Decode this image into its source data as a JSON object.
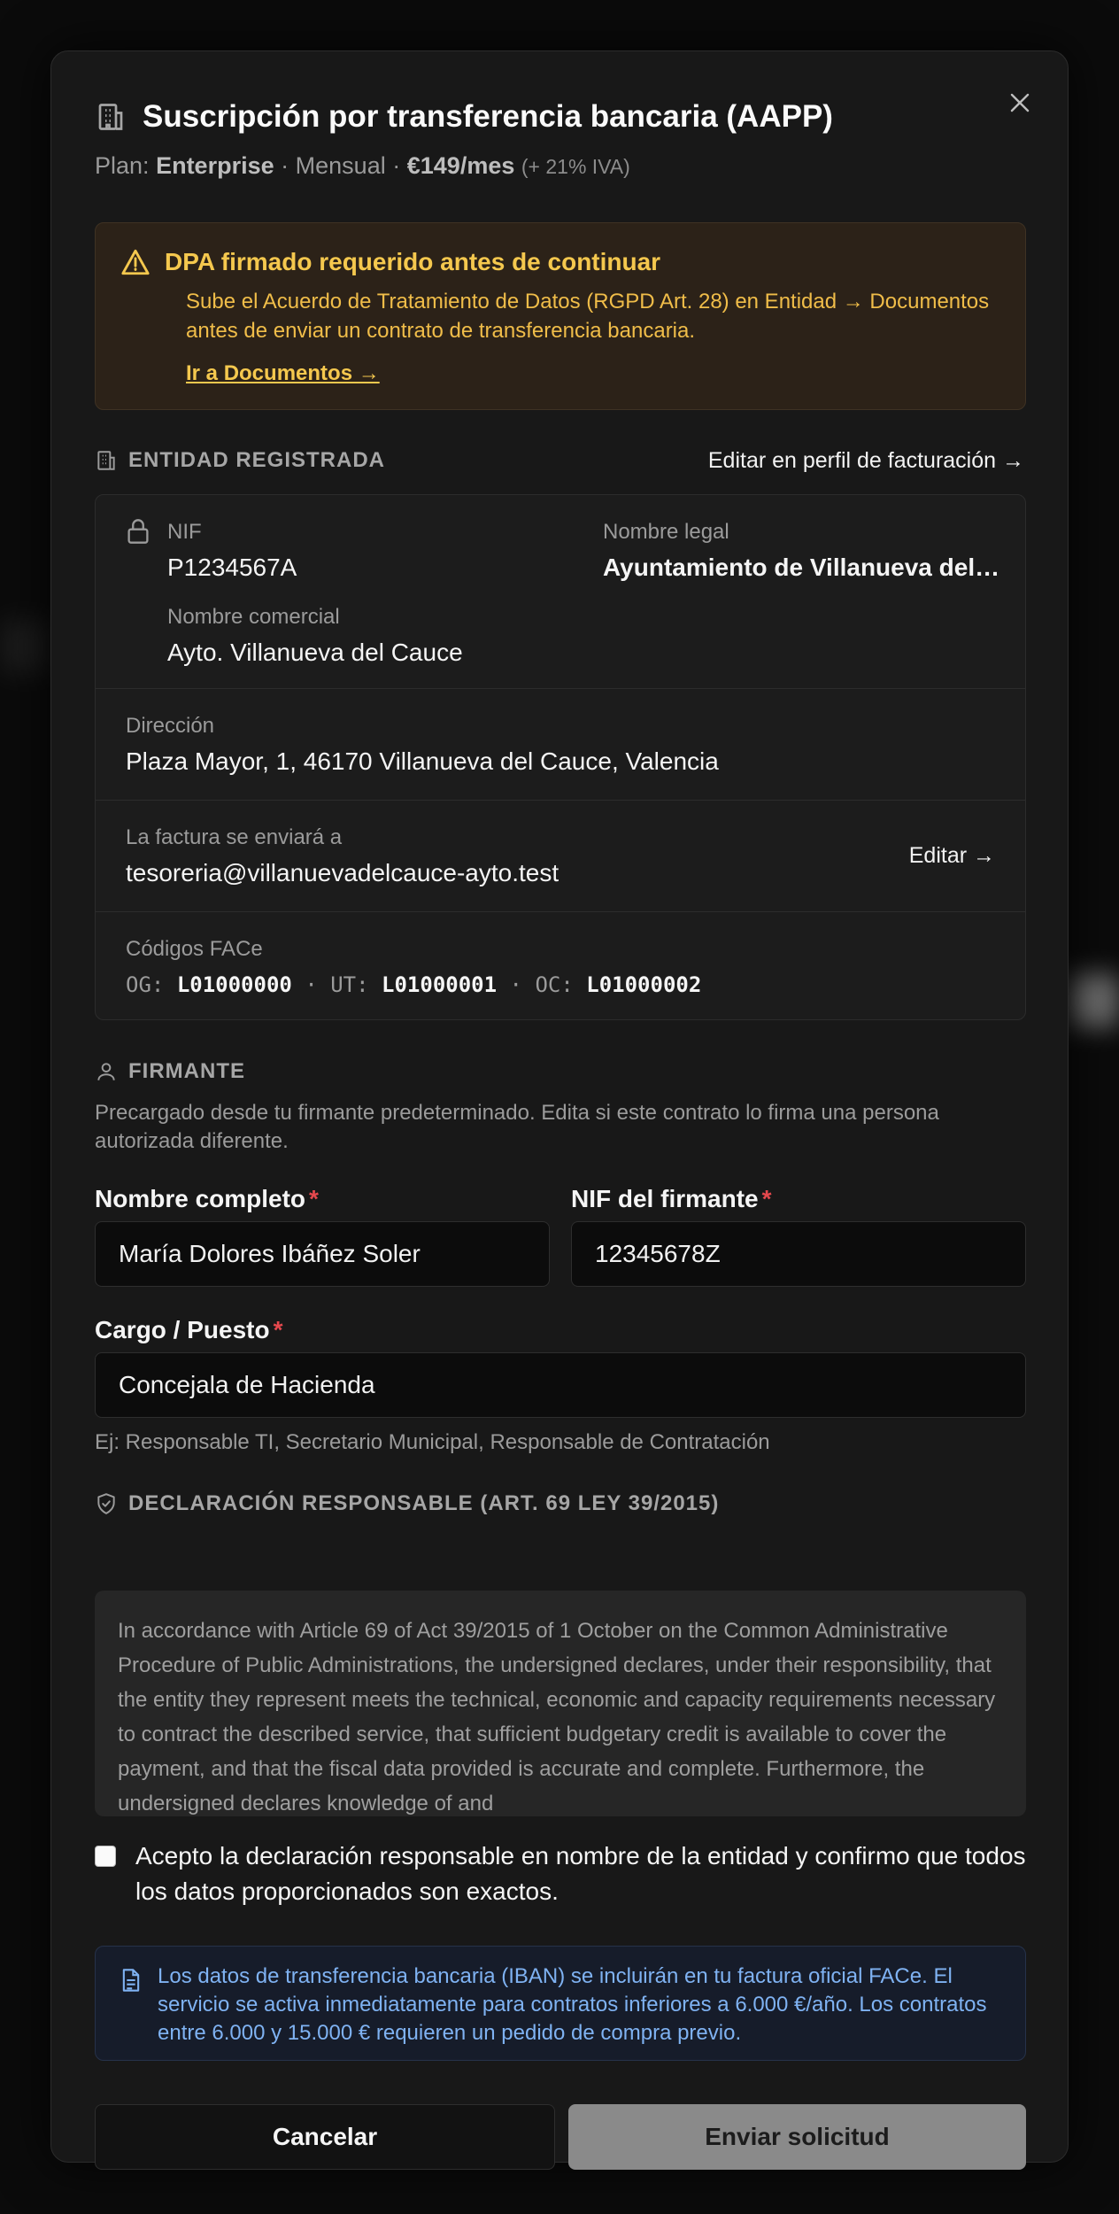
{
  "modal": {
    "title": "Suscripción por transferencia bancaria (AAPP)",
    "plan_prefix": "Plan:",
    "plan_name": "Enterprise",
    "plan_sep1": "·",
    "plan_period": "Mensual",
    "plan_sep2": "·",
    "plan_price": "€149/mes",
    "plan_tax": "(+ 21% IVA)",
    "close_icon": "close-icon"
  },
  "warning": {
    "title": "DPA firmado requerido antes de continuar",
    "body": "Sube el Acuerdo de Tratamiento de Datos (RGPD Art. 28) en Entidad → Documentos antes de enviar un contrato de transferencia bancaria.",
    "link": "Ir a Documentos →",
    "color": "#f5c84e"
  },
  "entity": {
    "section_label": "ENTIDAD REGISTRADA",
    "edit_link": "Editar en perfil de facturación →",
    "nif_label": "NIF",
    "nif_value": "P1234567A",
    "legal_name_label": "Nombre legal",
    "legal_name_value": "Ayuntamiento de Villanueva del Cauce",
    "trade_name_label": "Nombre comercial",
    "trade_name_value": "Ayto. Villanueva del Cauce",
    "address_label": "Dirección",
    "address_value": "Plaza Mayor, 1, 46170 Villanueva del Cauce, Valencia",
    "invoice_label": "La factura se enviará a",
    "invoice_value": "tesoreria@villanuevadelcauce-ayto.test",
    "invoice_edit": "Editar →",
    "face_label": "Códigos FACe",
    "face_og_key": "OG:",
    "face_og": "L01000000",
    "face_ut_key": "UT:",
    "face_ut": "L01000001",
    "face_oc_key": "OC:",
    "face_oc": "L01000002",
    "face_sep": "·"
  },
  "signer": {
    "section_label": "FIRMANTE",
    "hint": "Precargado desde tu firmante predeterminado. Edita si este contrato lo firma una persona autorizada diferente.",
    "name_label": "Nombre completo",
    "name_value": "María Dolores Ibáñez Soler",
    "nif_label": "NIF del firmante",
    "nif_value": "12345678Z",
    "role_label": "Cargo / Puesto",
    "role_value": "Concejala de Hacienda",
    "role_hint": "Ej: Responsable TI, Secretario Municipal, Responsable de Contratación",
    "required_mark": "*"
  },
  "declaration": {
    "section_label": "DECLARACIÓN RESPONSABLE (ART. 69 LEY 39/2015)",
    "text": "In accordance with Article 69 of Act 39/2015 of 1 October on the Common Administrative Procedure of Public Administrations, the undersigned declares, under their responsibility, that the entity they represent meets the technical, economic and capacity requirements necessary to contract the described service, that sufficient budgetary credit is available to cover the payment, and that the fiscal data provided is accurate and complete. Furthermore, the undersigned declares knowledge of and",
    "checkbox_label": "Acepto la declaración responsable en nombre de la entidad y confirmo que todos los datos proporcionados son exactos.",
    "checked": false
  },
  "info": {
    "text": "Los datos de transferencia bancaria (IBAN) se incluirán en tu factura oficial FACe. El servicio se activa inmediatamente para contratos inferiores a 6.000 €/año. Los contratos entre 6.000 y 15.000 € requieren un pedido de compra previo.",
    "color": "#7fb2f2"
  },
  "actions": {
    "cancel": "Cancelar",
    "submit": "Enviar solicitud"
  }
}
